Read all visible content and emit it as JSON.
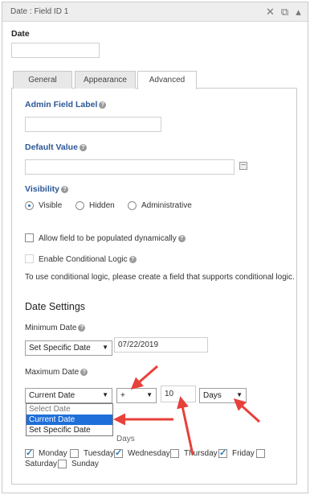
{
  "panel": {
    "title": "Date : Field ID 1",
    "icons": [
      "close-icon",
      "duplicate-icon",
      "collapse-icon"
    ]
  },
  "field": {
    "label": "Date",
    "value": ""
  },
  "tabs": [
    {
      "label": "General"
    },
    {
      "label": "Appearance"
    },
    {
      "label": "Advanced",
      "active": true
    }
  ],
  "advanced": {
    "admin_label": {
      "label": "Admin Field Label",
      "value": ""
    },
    "default_value": {
      "label": "Default Value",
      "value": ""
    },
    "visibility": {
      "label": "Visibility",
      "options": [
        "Visible",
        "Hidden",
        "Administrative"
      ],
      "selected": "Visible"
    },
    "populate_dynamic": {
      "label": "Allow field to be populated dynamically",
      "checked": false
    },
    "conditional_logic": {
      "label": "Enable Conditional Logic",
      "checked": false,
      "disabled": true
    },
    "conditional_note": "To use conditional logic, please create a field that supports conditional logic."
  },
  "date_settings": {
    "title": "Date Settings",
    "min_date": {
      "label": "Minimum Date",
      "type_value": "Set Specific Date",
      "date_value": "07/22/2019"
    },
    "max_date": {
      "label": "Maximum Date",
      "type_value": "Current Date",
      "operator_value": "+",
      "number_value": "10",
      "unit_value": "Days",
      "dropdown_options": [
        "Select Date",
        "Current Date",
        "Set Specific Date"
      ],
      "dropdown_selected": "Current Date"
    },
    "hidden_label_fragment": "Days",
    "days": [
      {
        "label": "Monday",
        "checked": true
      },
      {
        "label": "Tuesday",
        "checked": false
      },
      {
        "label": "Wednesday",
        "checked": true
      },
      {
        "label": "Thursday",
        "checked": false
      },
      {
        "label": "Friday",
        "checked": true
      },
      {
        "label": "Saturday",
        "checked": false
      },
      {
        "label": "Sunday",
        "checked": false
      }
    ]
  },
  "colors": {
    "accent": "#2b5797",
    "annotation": "#e8403a",
    "selected": "#1e6fd9"
  }
}
